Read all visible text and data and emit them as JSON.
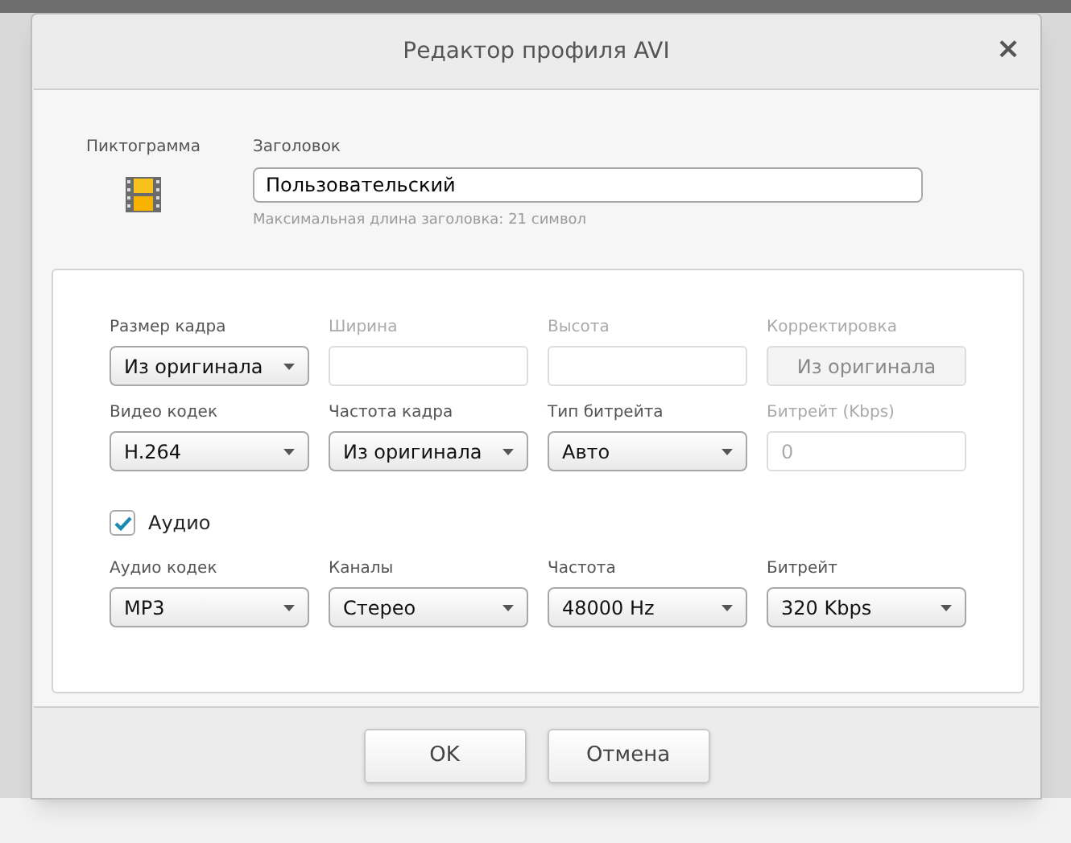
{
  "dialog": {
    "title": "Редактор профиля AVI",
    "close": "×"
  },
  "header": {
    "icon_label": "Пиктограмма",
    "title_label": "Заголовок",
    "title_value": "Пользовательский",
    "title_hint": "Максимальная длина заголовка: 21 символ"
  },
  "video_rows": [
    [
      {
        "label": "Размер кадра",
        "kind": "dropdown",
        "value": "Из оригинала",
        "disabled": false
      },
      {
        "label": "Ширина",
        "kind": "input",
        "disabled": true
      },
      {
        "label": "Высота",
        "kind": "input",
        "disabled": true
      },
      {
        "label": "Корректировка",
        "kind": "button",
        "value": "Из оригинала",
        "disabled": true
      }
    ],
    [
      {
        "label": "Видео кодек",
        "kind": "dropdown",
        "value": "H.264",
        "disabled": false
      },
      {
        "label": "Частота кадра",
        "kind": "dropdown",
        "value": "Из оригинала",
        "disabled": false
      },
      {
        "label": "Тип битрейта",
        "kind": "dropdown",
        "value": "Авто",
        "disabled": false
      },
      {
        "label": "Битрейт (Kbps)",
        "kind": "input",
        "value": "0",
        "disabled": true
      }
    ]
  ],
  "audio": {
    "label": "Аудио",
    "checked": true,
    "fields": [
      {
        "label": "Аудио кодек",
        "kind": "dropdown",
        "value": "MP3",
        "disabled": false
      },
      {
        "label": "Каналы",
        "kind": "dropdown",
        "value": "Стерео",
        "disabled": false
      },
      {
        "label": "Частота",
        "kind": "dropdown",
        "value": "48000 Hz",
        "disabled": false
      },
      {
        "label": "Битрейт",
        "kind": "dropdown",
        "value": "320 Kbps",
        "disabled": false
      }
    ]
  },
  "buttons": [
    {
      "label": "OK"
    },
    {
      "label": "Отмена"
    }
  ]
}
